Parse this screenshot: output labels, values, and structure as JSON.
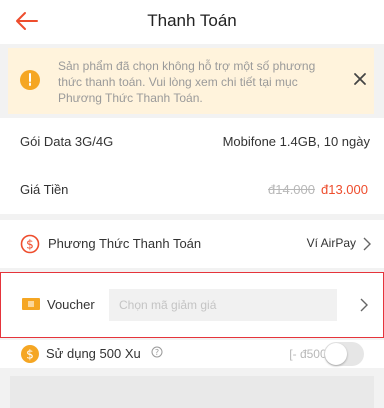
{
  "header": {
    "title": "Thanh Toán",
    "back_icon": "arrow-left-icon",
    "accent": "#ee4d2d"
  },
  "notice": {
    "text": "Sản phẩm đã chọn không hỗ trợ một số phương thức thanh toán. Vui lòng xem chi tiết tại mục Phương Thức Thanh Toán.",
    "icon": "warning-icon",
    "close_icon": "close-icon",
    "background": "#fff3dc"
  },
  "package": {
    "label": "Gói Data 3G/4G",
    "value": "Mobifone 1.4GB, 10 ngày"
  },
  "price": {
    "label": "Giá Tiền",
    "old_price": "đ14.000",
    "new_price": "đ13.000",
    "new_price_color": "#ee4d2d"
  },
  "payment": {
    "label": "Phương Thức Thanh Toán",
    "value": "Ví AirPay",
    "icon": "dollar-circle-icon"
  },
  "voucher": {
    "label": "Voucher",
    "placeholder": "Chọn mã giảm giá",
    "icon": "ticket-icon",
    "highlight_color": "#e5343b"
  },
  "coins": {
    "label": "Sử dụng 500 Xu",
    "value": "[- đ500]",
    "icon": "coin-icon",
    "info_icon": "question-circle-icon",
    "toggle_on": false
  }
}
